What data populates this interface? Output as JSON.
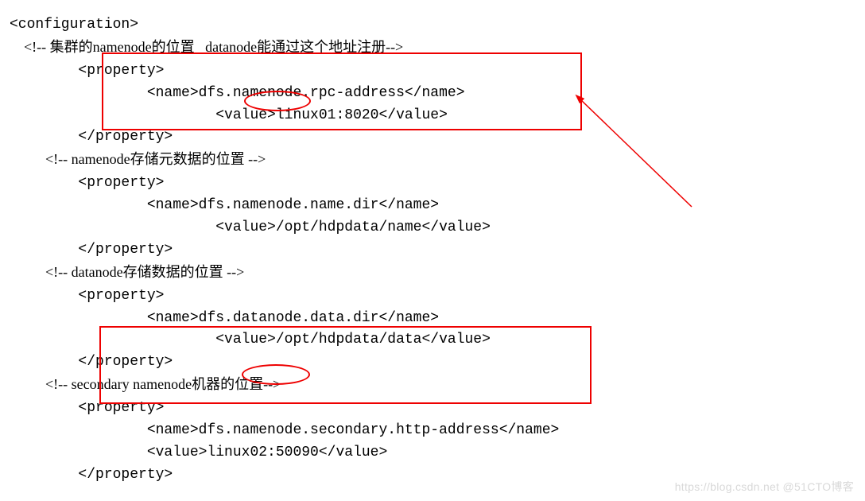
{
  "code": {
    "l1": "<configuration>\n",
    "c1": "    <!-- 集群的namenode的位置   datanode能通过这个地址注册-->\n",
    "l3": "        <property>\n",
    "l4": "                <name>dfs.namenode.rpc-address</name>\n",
    "l5": "                        <value>linux01:8020</value>\n",
    "l6": "        </property>\n",
    "c2": "          <!-- namenode存储元数据的位置 -->\n",
    "l8": "        <property>\n",
    "l9": "                <name>dfs.namenode.name.dir</name>\n",
    "l10": "                        <value>/opt/hdpdata/name</value>\n",
    "l11": "        </property>\n",
    "c3": "          <!-- datanode存储数据的位置 -->\n",
    "l13": "        <property>\n",
    "l14": "                <name>dfs.datanode.data.dir</name>\n",
    "l15": "                        <value>/opt/hdpdata/data</value>\n",
    "l16": "        </property>\n",
    "c4": "          <!-- secondary namenode机器的位置-->\n",
    "l18": "        <property>\n",
    "l19": "                <name>dfs.namenode.secondary.http-address</name>\n",
    "l20": "                <value>linux02:50090</value>\n",
    "l21": "        </property>\n"
  },
  "watermark": "https://blog.csdn.net @51CTO博客"
}
